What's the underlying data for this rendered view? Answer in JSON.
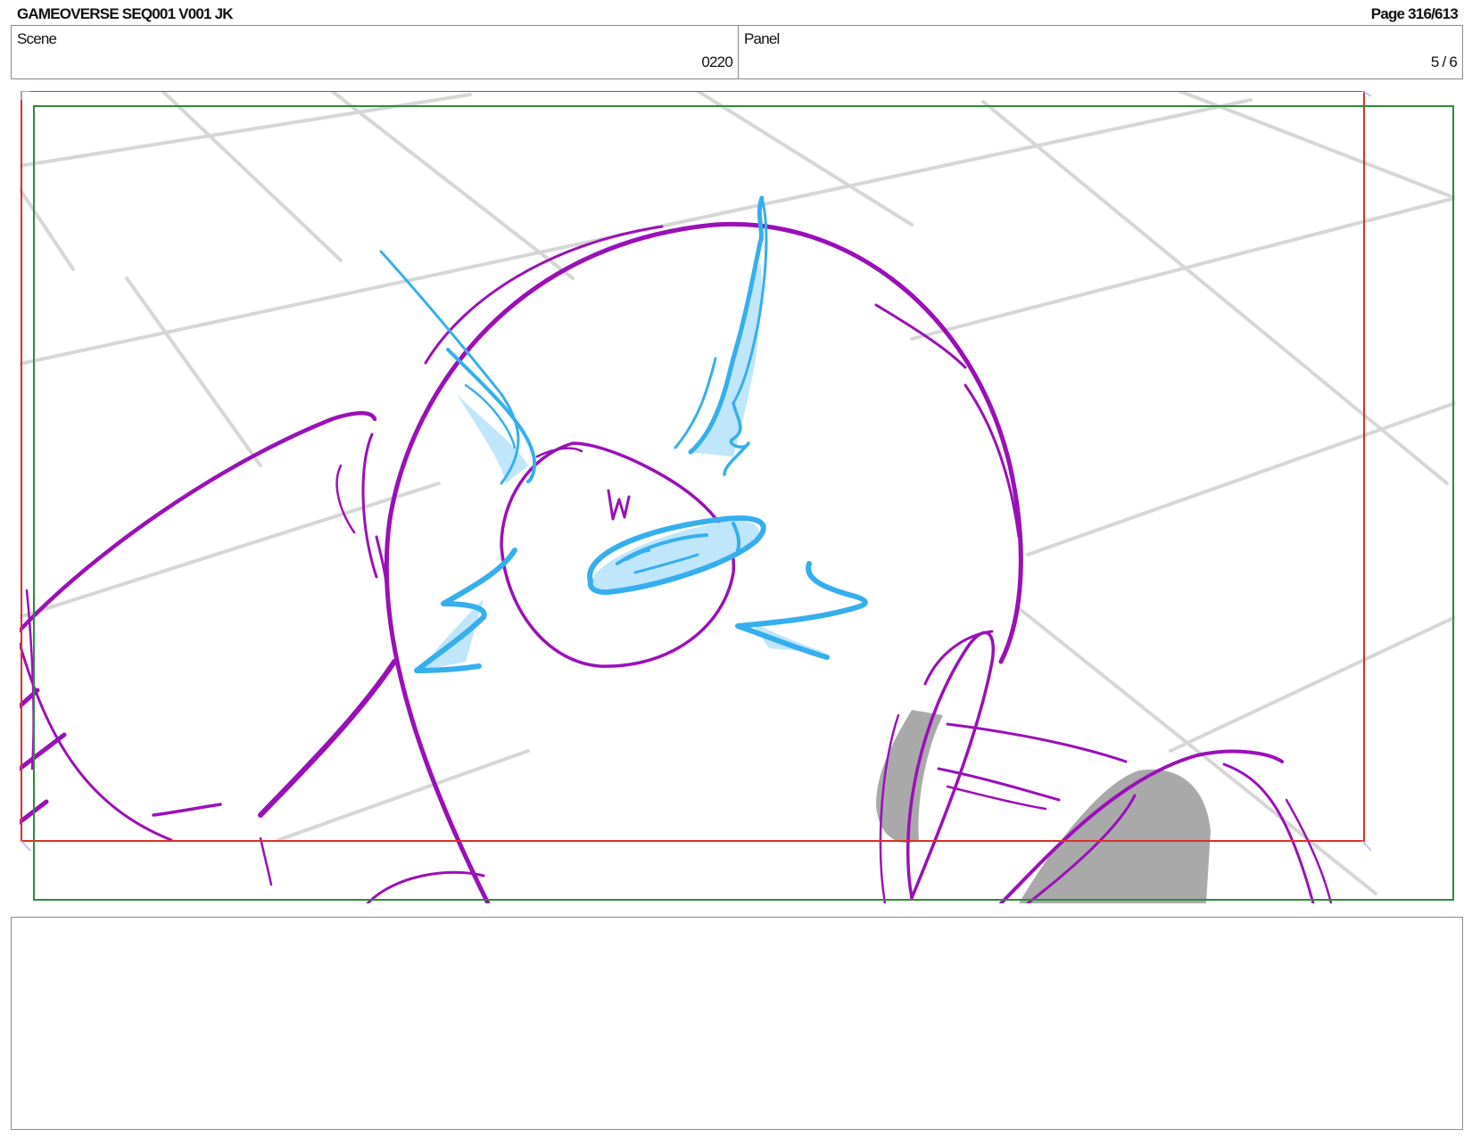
{
  "header": {
    "title": "GAMEOVERSE SEQ001 V001 JK",
    "page": "Page 316/613"
  },
  "info": {
    "scene_label": "Scene",
    "scene_value": "0220",
    "panel_label": "Panel",
    "panel_value": "5 / 6"
  },
  "notes": {
    "text": ""
  },
  "colors": {
    "safe_frame": "#d9302a",
    "camera_frame": "#2f8a3a",
    "character_line": "#9a10b8",
    "accent_line": "#36aeee",
    "accent_fill": "#bfe6fb",
    "shadow_fill": "#a9a9a9",
    "grid_line": "#d6d6d6"
  }
}
